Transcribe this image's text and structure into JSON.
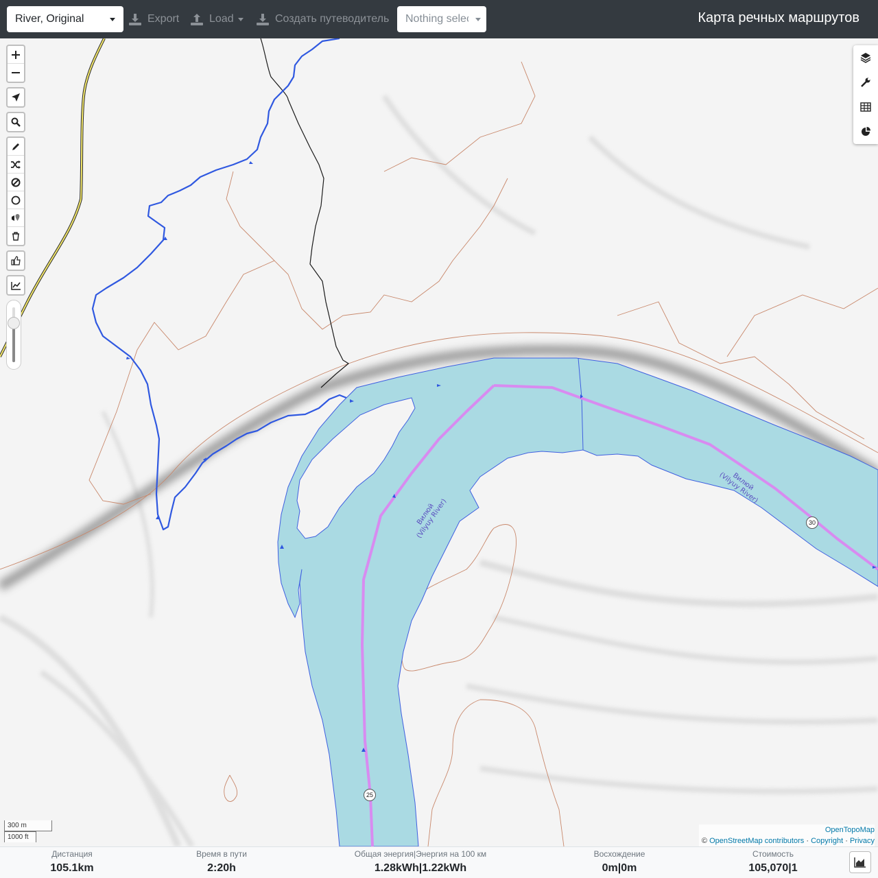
{
  "navbar": {
    "profile": "River, Original",
    "export_label": "Export",
    "load_label": "Load",
    "guide_label": "Создать путеводитель",
    "selection": "Nothing selected",
    "title": "Карта речных маршрутов"
  },
  "map": {
    "river_label_1_line1": "Вилюй",
    "river_label_1_line2": "(Vilyuy River)",
    "river_label_2_line1": "Вилюй",
    "river_label_2_line2": "(Vilyuy River)",
    "km_marker_30": "30",
    "km_marker_25": "25",
    "colors": {
      "water": "#aadae3",
      "water_outline": "#3f5fe0",
      "route": "#d88bf0",
      "stream": "#2f58e0",
      "contour": "#c8876a",
      "road_casing": "#2a2a2a",
      "road_fill": "#f3e76a"
    }
  },
  "left_toolbar": {
    "zoom_in_icon": "plus-icon",
    "zoom_out_icon": "minus-icon",
    "locate_icon": "location-arrow-icon",
    "search_icon": "search-icon",
    "draw_icon": "pencil-icon",
    "shuffle_icon": "shuffle-icon",
    "nogo_icon": "ban-icon",
    "circle_icon": "circle-icon",
    "poi_icon": "map-pin-icon",
    "delete_icon": "trash-icon",
    "like_icon": "thumbs-up-icon",
    "elevation_icon": "line-chart-icon",
    "zoom_level_fraction": 0.3
  },
  "right_toolbar": {
    "layers_icon": "layers-icon",
    "settings_icon": "wrench-icon",
    "table_icon": "table-icon",
    "stats_icon": "pie-chart-icon"
  },
  "scale": {
    "metric": "300 m",
    "imperial": "1000 ft"
  },
  "attribution": {
    "provider": "OpenTopoMap",
    "copyright_symbol": "©",
    "osm": "OpenStreetMap contributors",
    "sep": "·",
    "copyright": "Copyright",
    "privacy": "Privacy"
  },
  "footer": {
    "distance_label": "Дистанция",
    "distance_value": "105.1",
    "distance_unit": "km",
    "time_label": "Время в пути",
    "time_value": "2:20",
    "time_unit": "h",
    "energy_label": "Общая энергия|Энергия на 100 км",
    "energy_total": "1.28",
    "energy_total_unit": "kWh",
    "energy_sep": "|",
    "energy_per100": "1.22",
    "energy_per100_unit": "kWh",
    "ascent_label": "Восхождение",
    "ascent_up": "0",
    "ascent_up_unit": "m",
    "ascent_sep": "|",
    "ascent_down": "0",
    "ascent_down_unit": "m",
    "cost_label": "Стоимость",
    "cost_value": "105,070",
    "cost_sep": "|",
    "cost_extra": "1",
    "chart_toggle_icon": "area-chart-icon"
  }
}
